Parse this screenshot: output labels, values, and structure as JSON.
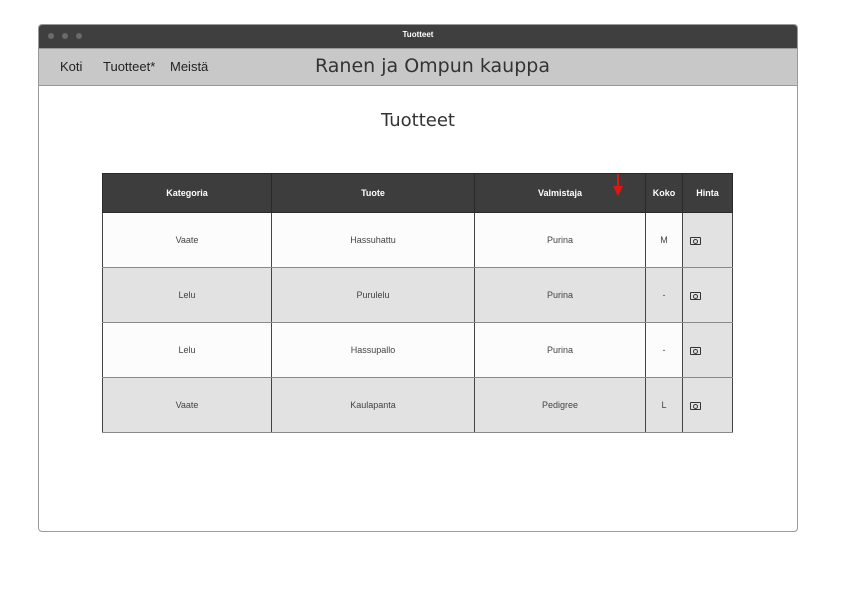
{
  "window": {
    "title": "Tuotteet"
  },
  "nav": {
    "items": [
      {
        "label": "Koti"
      },
      {
        "label": "Tuotteet*"
      },
      {
        "label": "Meistä"
      }
    ],
    "site_title": "Ranen ja Ompun kauppa"
  },
  "page": {
    "heading": "Tuotteet"
  },
  "table": {
    "headers": [
      "Kategoria",
      "Tuote",
      "Valmistaja",
      "Koko",
      "Hinta"
    ],
    "sorted_column": "Valmistaja",
    "price_icon": "money-icon",
    "rows": [
      {
        "category": "Vaate",
        "product": "Hassuhattu",
        "maker": "Purina",
        "size": "M"
      },
      {
        "category": "Lelu",
        "product": "Purulelu",
        "maker": "Purina",
        "size": "-"
      },
      {
        "category": "Lelu",
        "product": "Hassupallo",
        "maker": "Purina",
        "size": "-"
      },
      {
        "category": "Vaate",
        "product": "Kaulapanta",
        "maker": "Pedigree",
        "size": "L"
      }
    ]
  },
  "colors": {
    "titlebar": "#3f3f3f",
    "navbar": "#c8c8c8",
    "header": "#3d3d3d",
    "sort_arrow": "#e01515"
  }
}
